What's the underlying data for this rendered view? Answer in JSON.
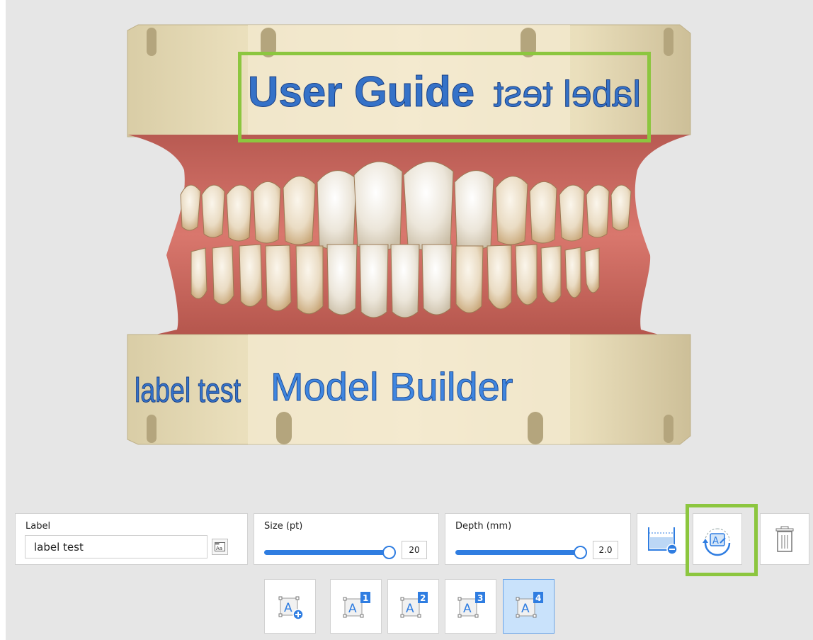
{
  "viewport": {
    "upper_label_text": "User Guide",
    "upper_label_mirrored": "label test",
    "lower_label_left": "label test",
    "lower_label_text": "Model Builder"
  },
  "label_panel": {
    "title": "Label",
    "value": "label test",
    "font_icon_text": "Aa"
  },
  "size_panel": {
    "title": "Size (pt)",
    "value": "20",
    "level_fraction": 1.0
  },
  "depth_panel": {
    "title": "Depth (mm)",
    "value": "2.0",
    "level_fraction": 1.0
  },
  "tools": [
    {
      "name": "remove-base-button",
      "icon": "base-minus-icon"
    },
    {
      "name": "edit-label-button",
      "icon": "rotate-edit-label-icon",
      "highlighted": true
    },
    {
      "name": "delete-button",
      "icon": "trash-icon"
    }
  ],
  "label_modes": [
    {
      "icon_letter": "A",
      "badge": "",
      "icon": "add-label-icon"
    },
    {
      "icon_letter": "A",
      "badge": "1"
    },
    {
      "icon_letter": "A",
      "badge": "2"
    },
    {
      "icon_letter": "A",
      "badge": "3"
    },
    {
      "icon_letter": "A",
      "badge": "4",
      "active": true
    }
  ],
  "colors": {
    "accent": "#2f7de1",
    "highlight": "#8cc63f",
    "label_blue": "#3f86e0",
    "base_cream": "#e9ddb8",
    "gum": "#c9665e",
    "tooth": "#efe3cf"
  }
}
